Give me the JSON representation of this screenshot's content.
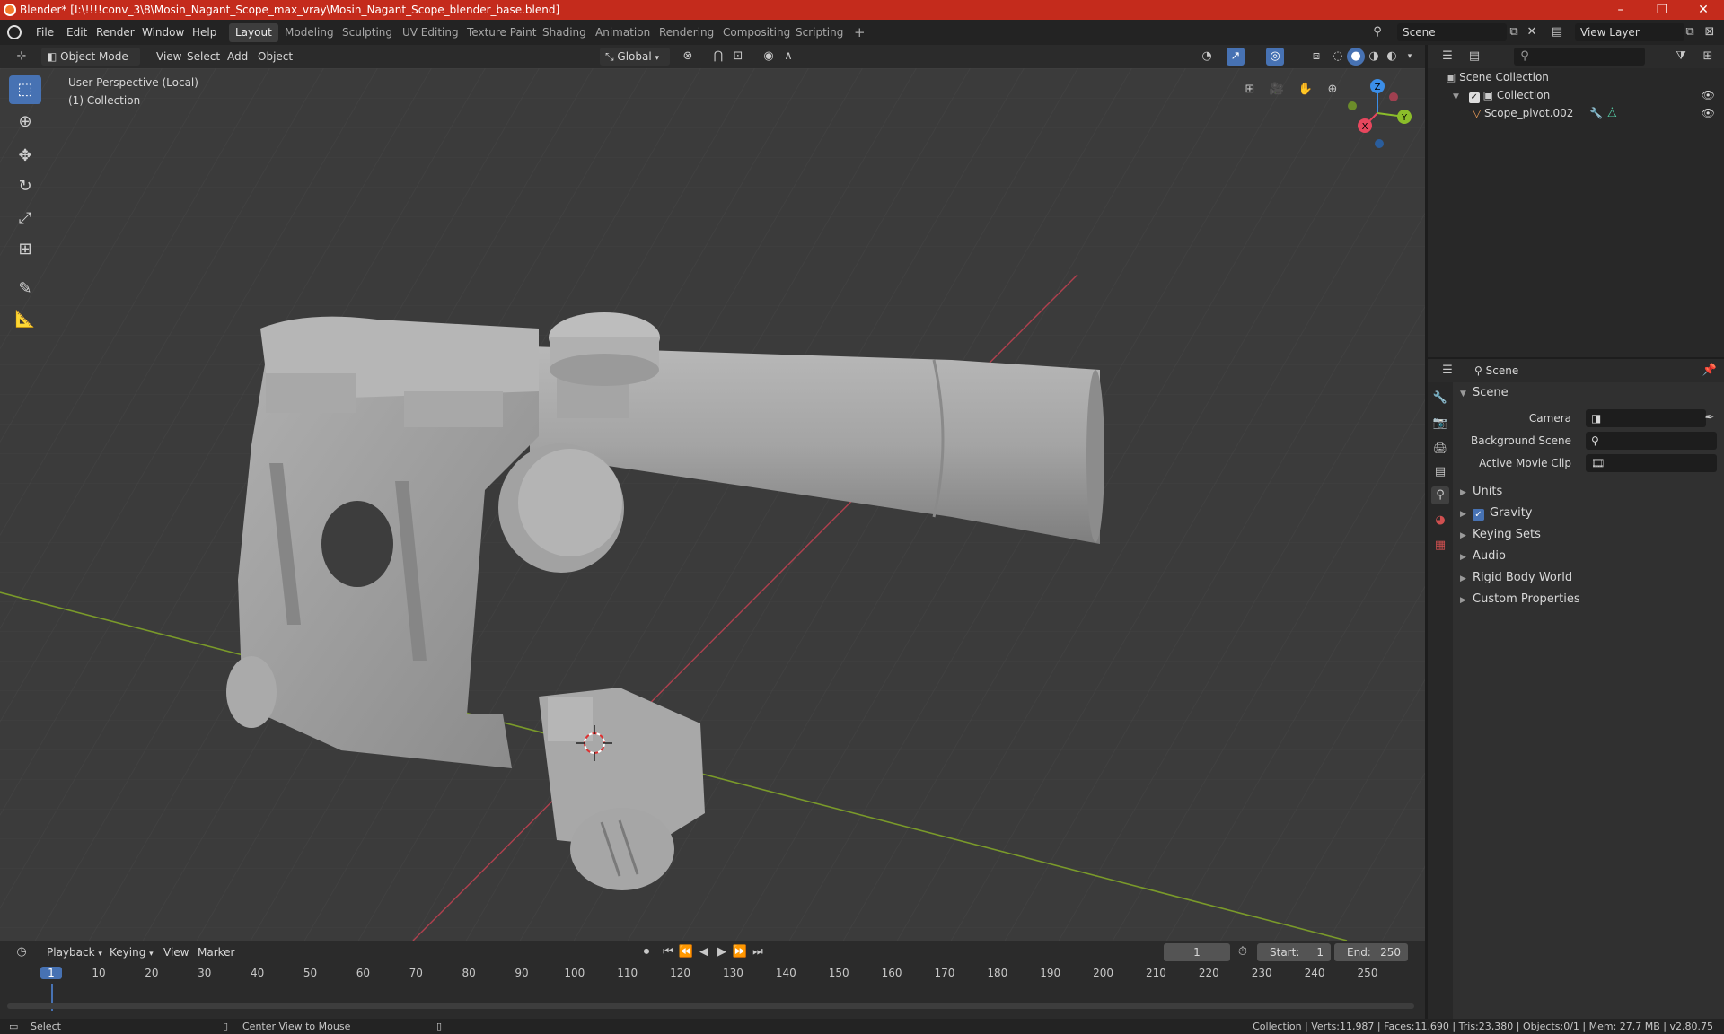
{
  "window": {
    "title": "Blender* [I:\\!!!!conv_3\\8\\Mosin_Nagant_Scope_max_vray\\Mosin_Nagant_Scope_blender_base.blend]",
    "minimize": "–",
    "maximize": "❐",
    "close": "✕"
  },
  "menubar": {
    "items": [
      "File",
      "Edit",
      "Render",
      "Window",
      "Help"
    ]
  },
  "workspaces": {
    "tabs": [
      "Layout",
      "Modeling",
      "Sculpting",
      "UV Editing",
      "Texture Paint",
      "Shading",
      "Animation",
      "Rendering",
      "Compositing",
      "Scripting"
    ],
    "active": "Layout",
    "add": "+"
  },
  "scene_selector": {
    "value": "Scene"
  },
  "viewlayer_selector": {
    "value": "View Layer"
  },
  "viewport_header": {
    "mode": "Object Mode",
    "menus": [
      "View",
      "Select",
      "Add",
      "Object"
    ],
    "transform_orientation": "Global"
  },
  "viewport": {
    "perspective": "User Perspective (Local)",
    "collection": "(1) Collection",
    "gizmo": {
      "z": "Z",
      "y": "Y",
      "x": "X"
    }
  },
  "outliner": {
    "search_placeholder": "",
    "root": "Scene Collection",
    "collection": "Collection",
    "object": "Scope_pivot.002"
  },
  "properties": {
    "header": "Scene",
    "section": "Scene",
    "camera_label": "Camera",
    "background_scene_label": "Background Scene",
    "active_movie_clip_label": "Active Movie Clip",
    "panels": [
      "Units",
      "Gravity",
      "Keying Sets",
      "Audio",
      "Rigid Body World",
      "Custom Properties"
    ],
    "gravity_checked": true
  },
  "timeline": {
    "menus": [
      "Playback",
      "Keying",
      "View",
      "Marker"
    ],
    "current_frame": "1",
    "start_label": "Start:",
    "start": "1",
    "end_label": "End:",
    "end": "250",
    "ticks": [
      "1",
      "10",
      "20",
      "30",
      "40",
      "50",
      "60",
      "70",
      "80",
      "90",
      "100",
      "110",
      "120",
      "130",
      "140",
      "150",
      "160",
      "170",
      "180",
      "190",
      "200",
      "210",
      "220",
      "230",
      "240",
      "250"
    ]
  },
  "statusbar": {
    "select": "Select",
    "center_view": "Center View to Mouse",
    "stats": "Collection | Verts:11,987 | Faces:11,690 | Tris:23,380 | Objects:0/1 | Mem: 27.7 MB | v2.80.75"
  },
  "colors": {
    "titlebar": "#c42b1c",
    "accent": "#4772b3",
    "x_axis": "#e8475e",
    "y_axis": "#8bbd2a",
    "z_axis": "#3b8ee8"
  }
}
